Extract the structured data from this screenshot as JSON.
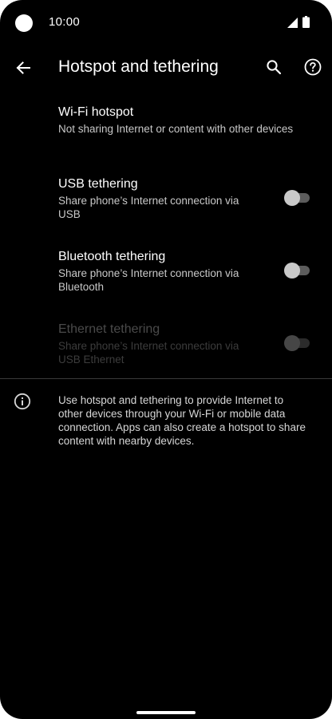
{
  "status_bar": {
    "time": "10:00"
  },
  "app_bar": {
    "title": "Hotspot and tethering",
    "back_icon": "arrow-back-icon",
    "search_icon": "search-icon",
    "help_icon": "help-icon"
  },
  "preferences": {
    "wifi_hotspot": {
      "title": "Wi-Fi hotspot",
      "summary": "Not sharing Internet or content with other devices"
    },
    "usb_tethering": {
      "title": "USB tethering",
      "summary": "Share phone’s Internet connection via USB",
      "enabled": true,
      "checked": false
    },
    "bluetooth_tethering": {
      "title": "Bluetooth tethering",
      "summary": "Share phone’s Internet connection via Bluetooth",
      "enabled": true,
      "checked": false
    },
    "ethernet_tethering": {
      "title": "Ethernet tethering",
      "summary": "Share phone’s Internet connection via USB Ethernet",
      "enabled": false,
      "checked": false
    }
  },
  "footer": {
    "info_text": "Use hotspot and tethering to provide Internet to other devices through your Wi-Fi or mobile data connection. Apps can also create a hotspot to share content with nearby devices.",
    "info_icon": "info-icon"
  },
  "colors": {
    "background": "#000000",
    "text_primary": "#ffffff",
    "text_secondary": "#c8c8c8",
    "text_disabled": "#4a4a4a"
  }
}
